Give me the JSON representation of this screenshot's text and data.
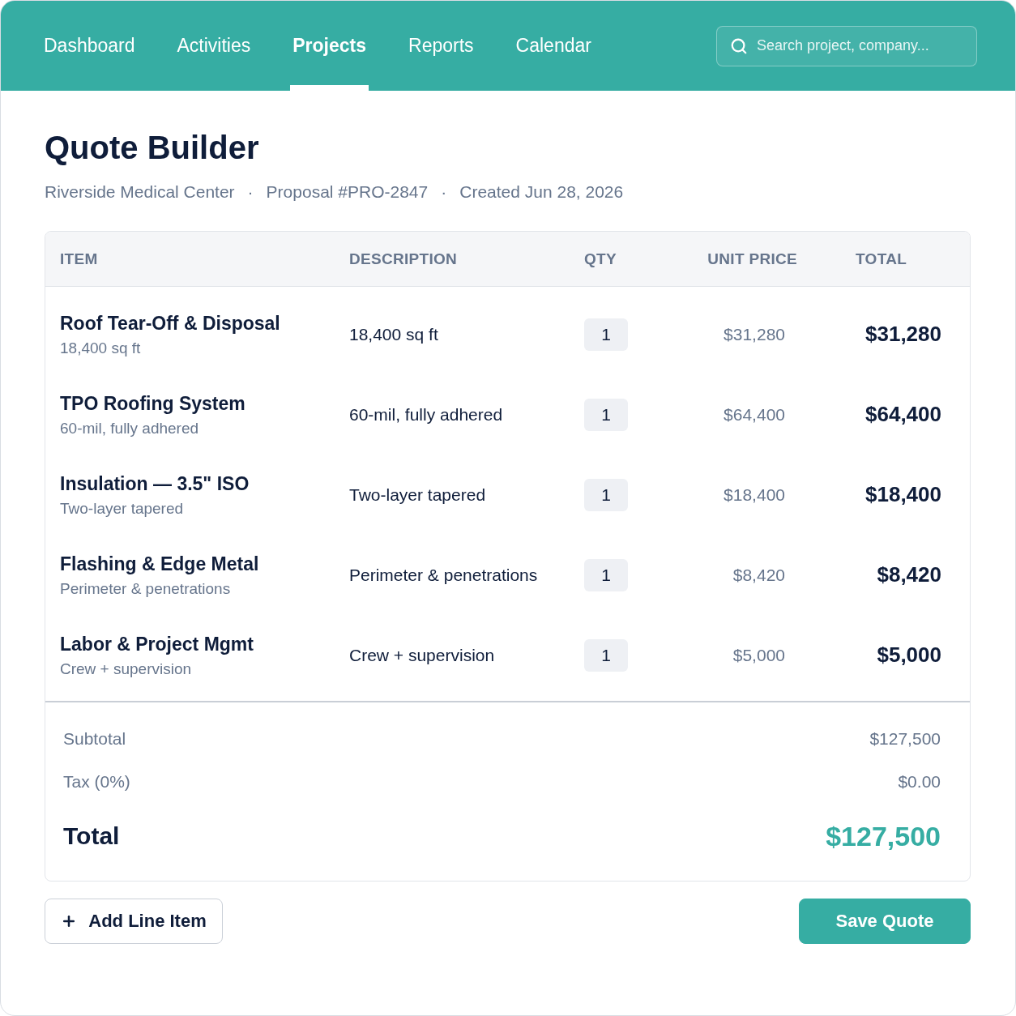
{
  "nav": {
    "tabs": [
      {
        "label": "Dashboard",
        "selected": false
      },
      {
        "label": "Activities",
        "selected": false
      },
      {
        "label": "Projects",
        "selected": true
      },
      {
        "label": "Reports",
        "selected": false
      },
      {
        "label": "Calendar",
        "selected": false
      }
    ],
    "search": {
      "placeholder": "Search project, company..."
    }
  },
  "page": {
    "title": "Quote Builder",
    "meta": [
      "Riverside Medical Center",
      "Proposal #PRO-2847",
      "Created Jun 28, 2026"
    ],
    "separator": "·"
  },
  "table": {
    "columns": [
      "ITEM",
      "DESCRIPTION",
      "QTY",
      "UNIT PRICE",
      "TOTAL"
    ],
    "rows": [
      {
        "item": "Roof Tear-Off & Disposal",
        "detail": "18,400 sq ft",
        "description": "18,400 sq ft",
        "qty": "1",
        "unit_price": "$31,280",
        "total": "$31,280"
      },
      {
        "item": "TPO Roofing System",
        "detail": "60-mil, fully adhered",
        "description": "60-mil, fully adhered",
        "qty": "1",
        "unit_price": "$64,400",
        "total": "$64,400"
      },
      {
        "item": "Insulation — 3.5\" ISO",
        "detail": "Two-layer tapered",
        "description": "Two-layer tapered",
        "qty": "1",
        "unit_price": "$18,400",
        "total": "$18,400"
      },
      {
        "item": "Flashing & Edge Metal",
        "detail": "Perimeter & penetrations",
        "description": "Perimeter & penetrations",
        "qty": "1",
        "unit_price": "$8,420",
        "total": "$8,420"
      },
      {
        "item": "Labor & Project Mgmt",
        "detail": "Crew + supervision",
        "description": "Crew + supervision",
        "qty": "1",
        "unit_price": "$5,000",
        "total": "$5,000"
      }
    ]
  },
  "summary": [
    {
      "kind": "line",
      "label": "Subtotal",
      "value": "$127,500"
    },
    {
      "kind": "line",
      "label": "Tax (0%)",
      "value": "$0.00"
    },
    {
      "kind": "grand",
      "label": "Total",
      "value": "$127,500"
    }
  ],
  "actions": [
    {
      "kind": "secondary",
      "label": "Add Line Item"
    },
    {
      "kind": "primary",
      "label": "Save Quote"
    }
  ]
}
